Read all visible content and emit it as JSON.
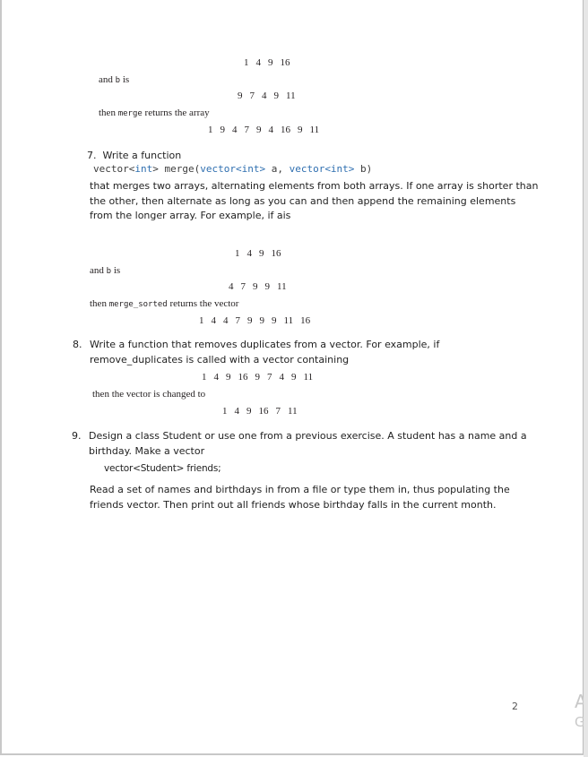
{
  "previous_example": {
    "array_a": [
      "1",
      "4",
      "9",
      "16"
    ],
    "and_b_prefix": "and ",
    "and_b_code": "b",
    "and_b_suffix": " is",
    "array_b": [
      "9",
      "7",
      "4",
      "9",
      "11"
    ],
    "then_prefix": "then ",
    "then_code": "merge",
    "then_suffix": " returns the array",
    "result": [
      "1",
      "9",
      "4",
      "7",
      "9",
      "4",
      "16",
      "9",
      "11"
    ]
  },
  "exercise7": {
    "number": "7.",
    "title": "Write a function",
    "signature": {
      "t1": "vector<",
      "k1": "int",
      "t2": "> merge(",
      "k2": "vector<int>",
      "t3": " a, ",
      "k3": "vector<int>",
      "t4": " b)"
    },
    "description_lines": [
      "that merges two arrays, alternating elements from both arrays. If one array is shorter than",
      "the other, then alternate as long as you can and then append the remaining elements",
      "from the longer array. For example, if ais"
    ],
    "array_a": [
      "1",
      "4",
      "9",
      "16"
    ],
    "and_b_prefix": "and ",
    "and_b_code": "b",
    "and_b_suffix": " is",
    "array_b": [
      "4",
      "7",
      "9",
      "9",
      "11"
    ],
    "then_prefix": "then ",
    "then_code": "merge_sorted",
    "then_suffix": " returns the vector",
    "result": [
      "1",
      "4",
      "4",
      "7",
      "9",
      "9",
      "9",
      "11",
      "16"
    ]
  },
  "exercise8": {
    "number": "8.",
    "lines": [
      "Write a function that removes duplicates from a vector. For example, if",
      "remove_duplicates is called with a vector containing"
    ],
    "input": [
      "1",
      "4",
      "9",
      "16",
      "9",
      "7",
      "4",
      "9",
      "11"
    ],
    "then_text": "then the vector is changed to",
    "result": [
      "1",
      "4",
      "9",
      "16",
      "7",
      "11"
    ]
  },
  "exercise9": {
    "number": "9.",
    "lines": [
      "Design a class Student or use one from a previous exercise. A student has a name and a",
      "birthday. Make a vector"
    ],
    "code": "vector<Student> friends;",
    "closing_lines": [
      "Read a set of names and birthdays in from a file or type them in, thus populating the",
      "friends vector. Then print out all friends whose birthday falls in the current month."
    ]
  },
  "footer": {
    "page_number": "2",
    "watermark_line1": "A",
    "watermark_line2": "G"
  }
}
